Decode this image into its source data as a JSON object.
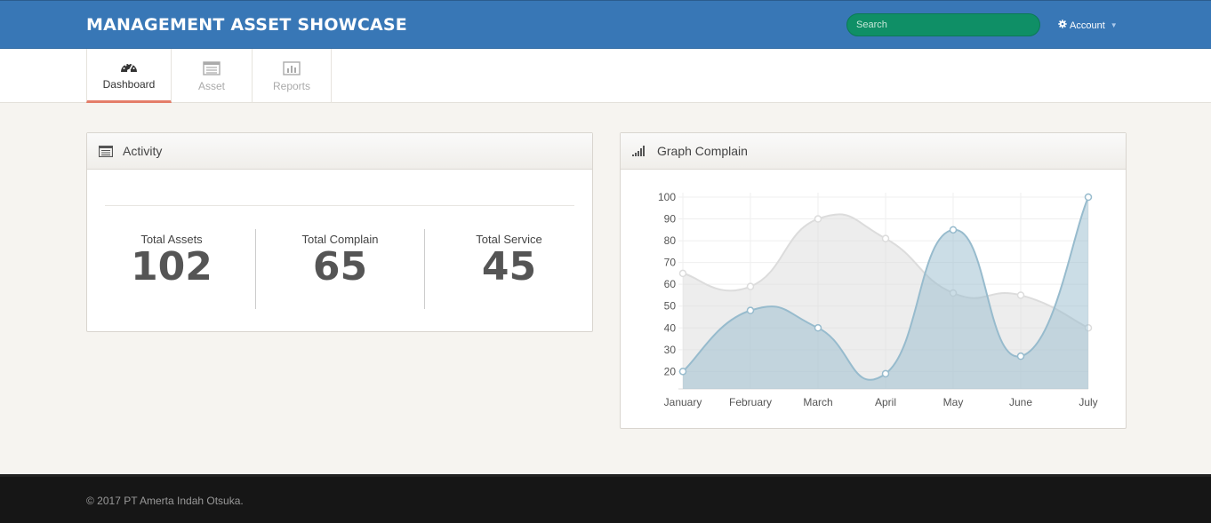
{
  "header": {
    "title": "MANAGEMENT ASSET SHOWCASE",
    "search_placeholder": "Search",
    "account_label": "Account"
  },
  "nav": {
    "tabs": [
      {
        "label": "Dashboard",
        "active": true
      },
      {
        "label": "Asset"
      },
      {
        "label": "Reports"
      }
    ]
  },
  "activity": {
    "title": "Activity",
    "stats": [
      {
        "label": "Total Assets",
        "value": "102"
      },
      {
        "label": "Total Complain",
        "value": "65"
      },
      {
        "label": "Total Service",
        "value": "45"
      }
    ]
  },
  "graph": {
    "title": "Graph Complain"
  },
  "chart_data": {
    "type": "area",
    "categories": [
      "January",
      "February",
      "March",
      "April",
      "May",
      "June",
      "July"
    ],
    "series": [
      {
        "values": [
          65,
          59,
          90,
          81,
          56,
          55,
          40
        ],
        "color": "#dcdcdc"
      },
      {
        "values": [
          20,
          48,
          40,
          19,
          85,
          27,
          100
        ],
        "color": "#97bbcd"
      }
    ],
    "yticks": [
      20,
      30,
      40,
      50,
      60,
      70,
      80,
      90,
      100
    ],
    "ylim": [
      12,
      100
    ],
    "grid": true
  },
  "footer": {
    "text": "© 2017 PT Amerta Indah Otsuka."
  }
}
